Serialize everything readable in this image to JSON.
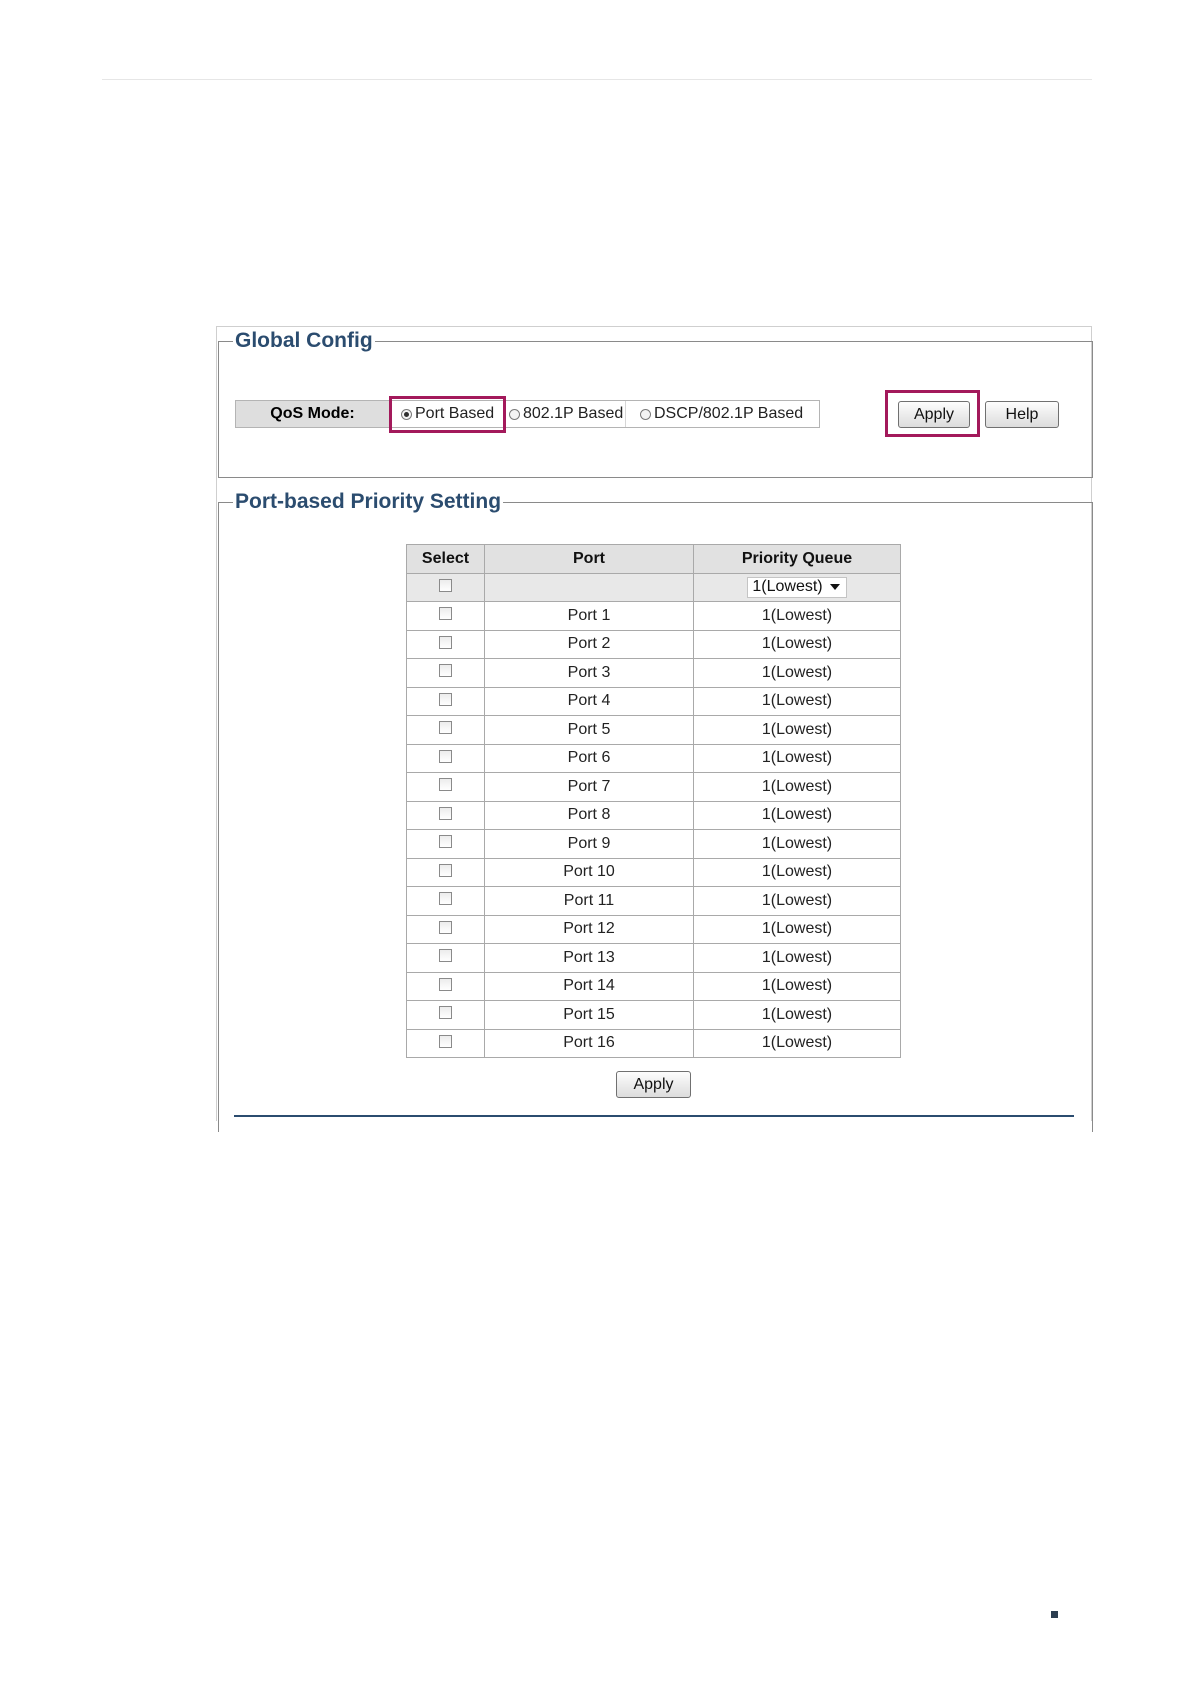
{
  "global_config": {
    "title": "Global Config",
    "qos_mode_label": "QoS Mode:",
    "options": [
      {
        "label": "Port Based",
        "selected": true
      },
      {
        "label": "802.1P Based",
        "selected": false
      },
      {
        "label": "DSCP/802.1P Based",
        "selected": false
      }
    ],
    "apply_label": "Apply",
    "help_label": "Help"
  },
  "port_priority": {
    "title": "Port-based Priority Setting",
    "headers": {
      "select": "Select",
      "port": "Port",
      "priority": "Priority Queue"
    },
    "filter_value": "1(Lowest)",
    "rows": [
      {
        "port": "Port 1",
        "priority": "1(Lowest)"
      },
      {
        "port": "Port 2",
        "priority": "1(Lowest)"
      },
      {
        "port": "Port 3",
        "priority": "1(Lowest)"
      },
      {
        "port": "Port 4",
        "priority": "1(Lowest)"
      },
      {
        "port": "Port 5",
        "priority": "1(Lowest)"
      },
      {
        "port": "Port 6",
        "priority": "1(Lowest)"
      },
      {
        "port": "Port 7",
        "priority": "1(Lowest)"
      },
      {
        "port": "Port 8",
        "priority": "1(Lowest)"
      },
      {
        "port": "Port 9",
        "priority": "1(Lowest)"
      },
      {
        "port": "Port 10",
        "priority": "1(Lowest)"
      },
      {
        "port": "Port 11",
        "priority": "1(Lowest)"
      },
      {
        "port": "Port 12",
        "priority": "1(Lowest)"
      },
      {
        "port": "Port 13",
        "priority": "1(Lowest)"
      },
      {
        "port": "Port 14",
        "priority": "1(Lowest)"
      },
      {
        "port": "Port 15",
        "priority": "1(Lowest)"
      },
      {
        "port": "Port 16",
        "priority": "1(Lowest)"
      }
    ],
    "apply_label": "Apply"
  },
  "colors": {
    "heading": "#2b4c6f",
    "highlight": "#a3195b",
    "header_bg": "#e1e1e1"
  }
}
